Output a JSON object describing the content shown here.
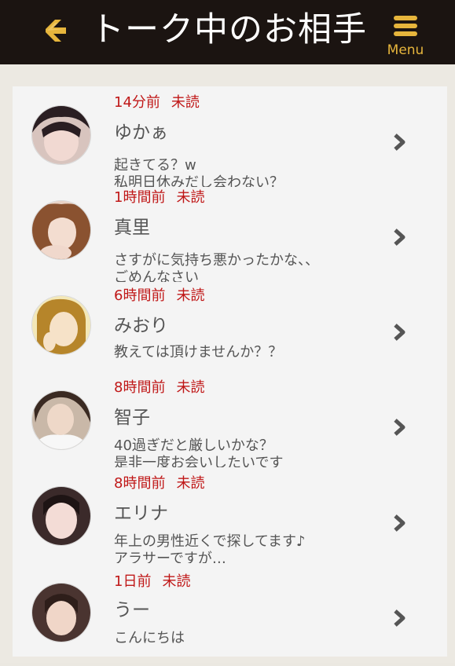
{
  "header": {
    "title": "トーク中のお相手",
    "menu_label": "Menu"
  },
  "colors": {
    "header_bg": "#1b1411",
    "accent": "#e6b53c",
    "unread_red": "#c01818"
  },
  "conversations": [
    {
      "time": "14分前",
      "status": "未読",
      "name": "ゆかぁ",
      "message": "起きてる？w\n私明日休みだし会わない？"
    },
    {
      "time": "1時間前",
      "status": "未読",
      "name": "真里",
      "message": "さすがに気持ち悪かったかな、、\nごめんなさい"
    },
    {
      "time": "6時間前",
      "status": "未読",
      "name": "みおり",
      "message": "教えては頂けませんか？？"
    },
    {
      "time": "8時間前",
      "status": "未読",
      "name": "智子",
      "message": "40過ぎだと厳しいかな？\n是非一度お会いしたいです"
    },
    {
      "time": "8時間前",
      "status": "未読",
      "name": "エリナ",
      "message": "年上の男性近くで探してます♪\nアラサーですが…"
    },
    {
      "time": "1日前",
      "status": "未読",
      "name": "うー",
      "message": "こんにちは"
    }
  ]
}
